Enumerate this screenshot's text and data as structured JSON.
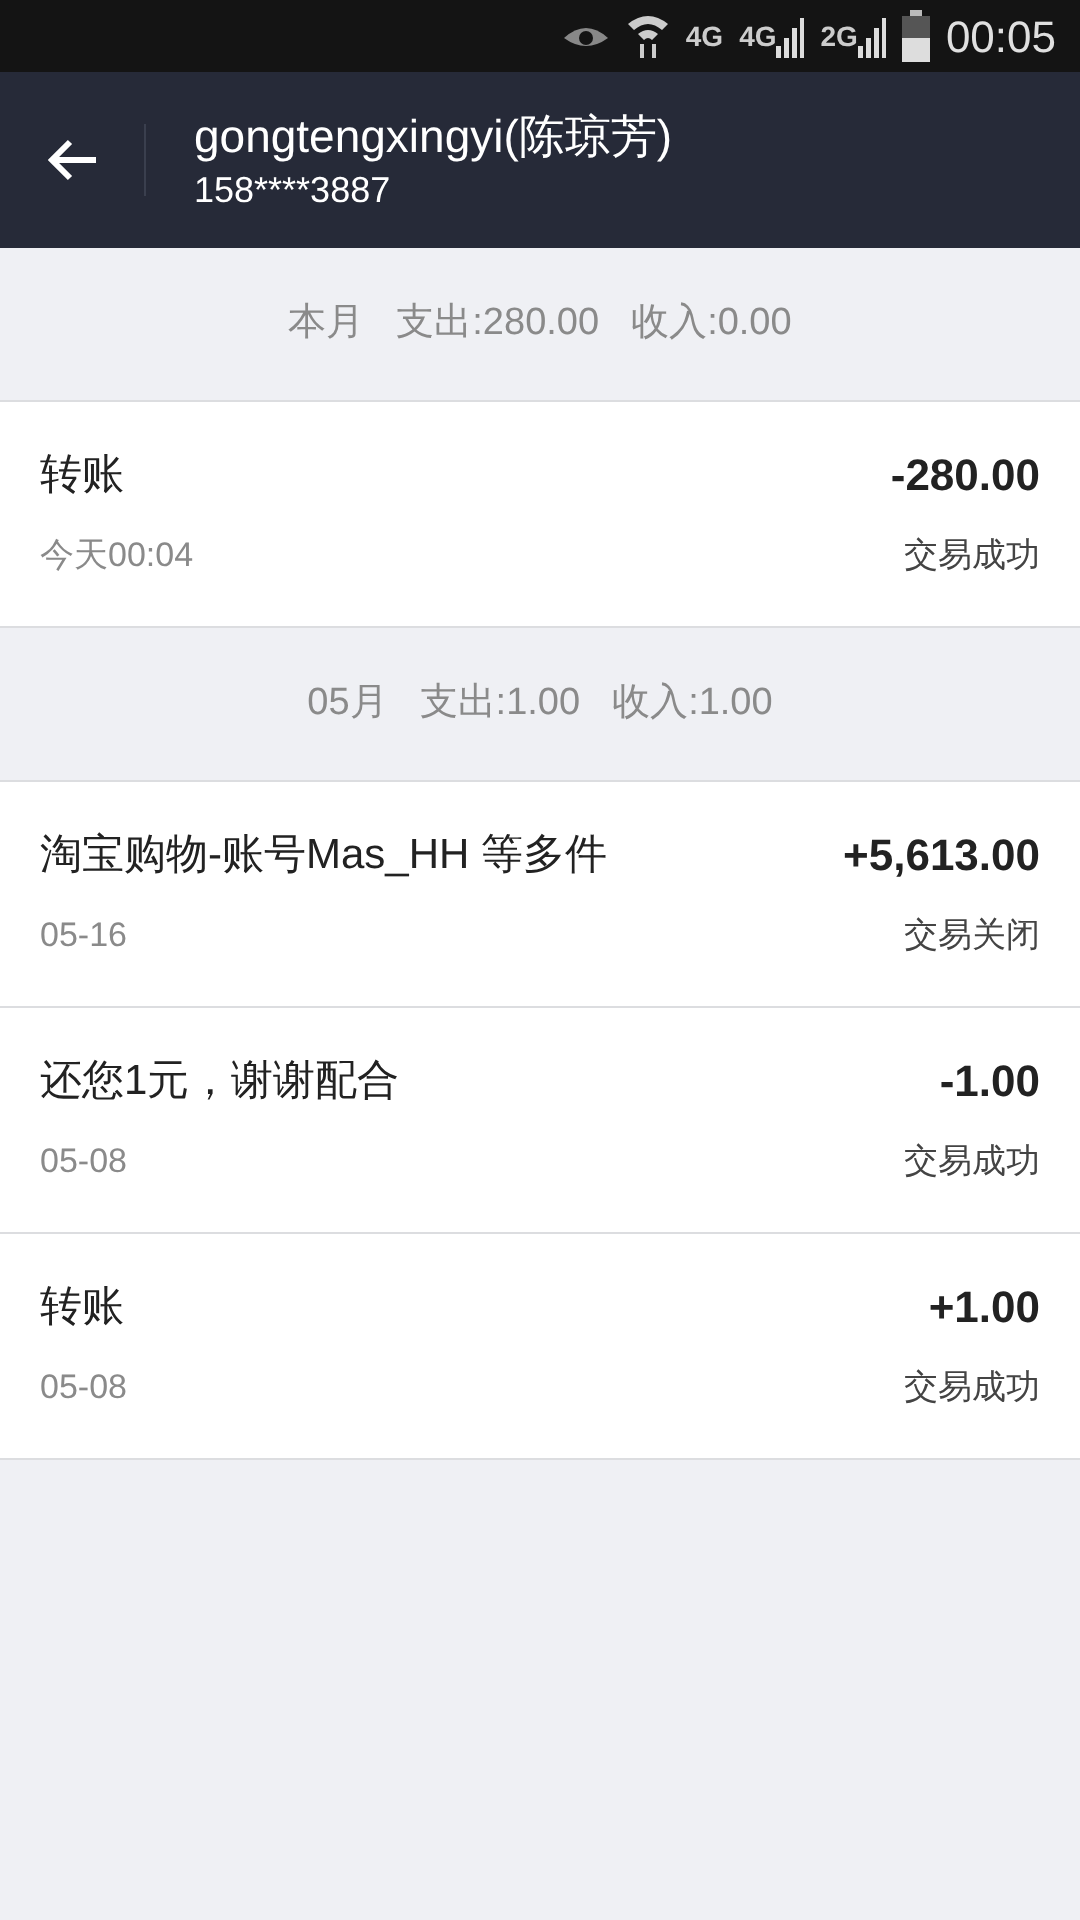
{
  "status_bar": {
    "networks": [
      "4G",
      "4G",
      "2G"
    ],
    "time": "00:05"
  },
  "header": {
    "title": "gongtengxingyi(陈琼芳)",
    "subtitle": "158****3887"
  },
  "groups": [
    {
      "month": "本月",
      "expense": "支出:280.00",
      "income": "收入:0.00",
      "items": [
        {
          "title": "转账",
          "date": "今天00:04",
          "amount": "-280.00",
          "status": "交易成功"
        }
      ]
    },
    {
      "month": "05月",
      "expense": "支出:1.00",
      "income": "收入:1.00",
      "items": [
        {
          "title": "淘宝购物-账号Mas_HH 等多件",
          "date": "05-16",
          "amount": "+5,613.00",
          "status": "交易关闭"
        },
        {
          "title": "还您1元，谢谢配合",
          "date": "05-08",
          "amount": "-1.00",
          "status": "交易成功"
        },
        {
          "title": "转账",
          "date": "05-08",
          "amount": "+1.00",
          "status": "交易成功"
        }
      ]
    }
  ]
}
